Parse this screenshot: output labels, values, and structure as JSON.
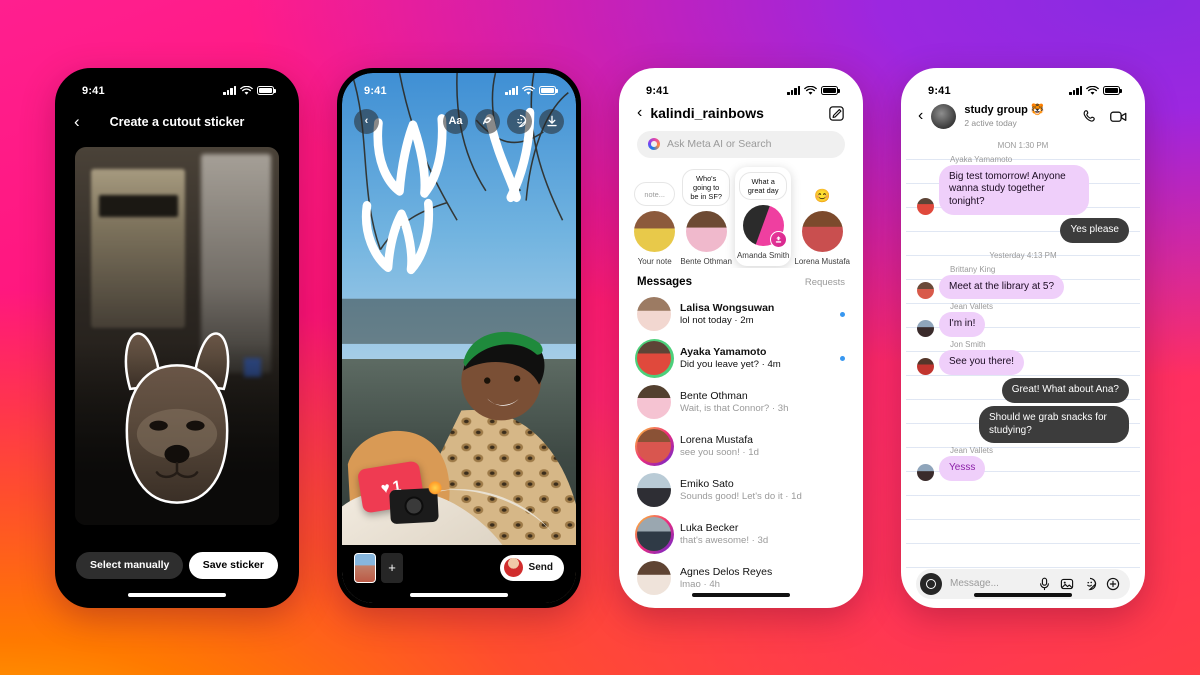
{
  "background": {
    "colors": [
      "#8a2be2",
      "#ff1f8f",
      "#ff7a00",
      "#ffb400"
    ]
  },
  "status_bar": {
    "time": "9:41",
    "signal_icon": "cellular-bars-icon",
    "wifi_icon": "wifi-icon",
    "battery_icon": "battery-icon"
  },
  "phone1": {
    "name": "cutout-sticker-screen",
    "back_icon": "back-chevron-icon",
    "title": "Create a cutout sticker",
    "photo_alt": "french-bulldog-cutout",
    "select_manually_label": "Select manually",
    "save_sticker_label": "Save sticker"
  },
  "phone2": {
    "name": "story-editor-screen",
    "back_icon": "back-chevron-icon",
    "tools": [
      {
        "icon": "text-tool-icon",
        "label": "Aa"
      },
      {
        "icon": "draw-tool-icon",
        "label": ""
      },
      {
        "icon": "sticker-tool-icon",
        "label": ""
      },
      {
        "icon": "download-icon",
        "label": ""
      }
    ],
    "stickers": [
      {
        "name": "like-notification-sticker",
        "count": "1",
        "icon": "heart-icon"
      },
      {
        "name": "camera-flash-sticker",
        "icon": "camera-icon"
      }
    ],
    "thumbnail_name": "media-thumbnail",
    "add_label": "+",
    "send_label": "Send"
  },
  "phone3": {
    "name": "direct-inbox-screen",
    "back_icon": "back-chevron-icon",
    "username": "kalindi_rainbows",
    "compose_icon": "compose-icon",
    "search": {
      "placeholder": "Ask Meta AI or Search",
      "icon": "meta-ai-icon"
    },
    "notes": [
      {
        "bubble": "note...",
        "name": "Your note",
        "emoji": "",
        "active": false,
        "badge": false
      },
      {
        "bubble": "Who's going to be in SF?",
        "name": "Bente Othman",
        "emoji": "",
        "active": false,
        "badge": false
      },
      {
        "bubble": "What a great day",
        "name": "Amanda Smith",
        "emoji": "",
        "active": true,
        "badge": true
      },
      {
        "bubble": "",
        "name": "Lorena Mustafa",
        "emoji": "😊",
        "active": false,
        "badge": false
      }
    ],
    "messages_label": "Messages",
    "requests_label": "Requests",
    "threads": [
      {
        "name": "Lalisa Wongsuwan",
        "preview": "lol not today · 2m",
        "unread": true,
        "ring": false
      },
      {
        "name": "Ayaka Yamamoto",
        "preview": "Did you leave yet? · 4m",
        "unread": true,
        "ring": true
      },
      {
        "name": "Bente Othman",
        "preview": "Wait, is that Connor? · 3h",
        "unread": false,
        "ring": false
      },
      {
        "name": "Lorena Mustafa",
        "preview": "see you soon! · 1d",
        "unread": false,
        "ring": true
      },
      {
        "name": "Emiko Sato",
        "preview": "Sounds good! Let's do it · 1d",
        "unread": false,
        "ring": false
      },
      {
        "name": "Luka Becker",
        "preview": "that's awesome! · 3d",
        "unread": false,
        "ring": true
      },
      {
        "name": "Agnes Delos Reyes",
        "preview": "lmao · 4h",
        "unread": false,
        "ring": false
      }
    ],
    "unread_dot_color": "#3897f0"
  },
  "phone4": {
    "name": "group-chat-screen",
    "back_icon": "back-chevron-icon",
    "group_name": "study group 🐯",
    "active_status": "2 active today",
    "call_icon": "phone-call-icon",
    "video_icon": "video-camera-icon",
    "timeline": [
      {
        "type": "daysep",
        "text": "MON 1:30 PM"
      },
      {
        "type": "sender",
        "text": "Ayaka Yamamoto"
      },
      {
        "type": "in",
        "text": "Big test tomorrow! Anyone wanna study together tonight?",
        "avatar": true
      },
      {
        "type": "out",
        "text": "Yes please"
      },
      {
        "type": "daysep",
        "text": "Yesterday 4:13 PM"
      },
      {
        "type": "sender",
        "text": "Brittany King"
      },
      {
        "type": "in",
        "text": "Meet at the library at 5?",
        "avatar": true
      },
      {
        "type": "sender",
        "text": "Jean Vallets"
      },
      {
        "type": "in",
        "text": "I'm in!",
        "avatar": true
      },
      {
        "type": "sender",
        "text": "Jon Smith"
      },
      {
        "type": "in",
        "text": "See you there!",
        "avatar": true
      },
      {
        "type": "out",
        "text": "Great! What about Ana?"
      },
      {
        "type": "out",
        "text": "Should we grab snacks for studying?"
      },
      {
        "type": "sender",
        "text": "Jean Vallets"
      },
      {
        "type": "in-accent",
        "text": "Yesss",
        "avatar": true
      }
    ],
    "composer": {
      "camera_icon": "camera-circle-icon",
      "placeholder": "Message...",
      "icons": [
        "microphone-icon",
        "photo-icon",
        "sticker-icon",
        "plus-circle-icon"
      ]
    },
    "incoming_bubble_color": "#efcffa",
    "outgoing_bubble_color": "#3c3c3c"
  }
}
